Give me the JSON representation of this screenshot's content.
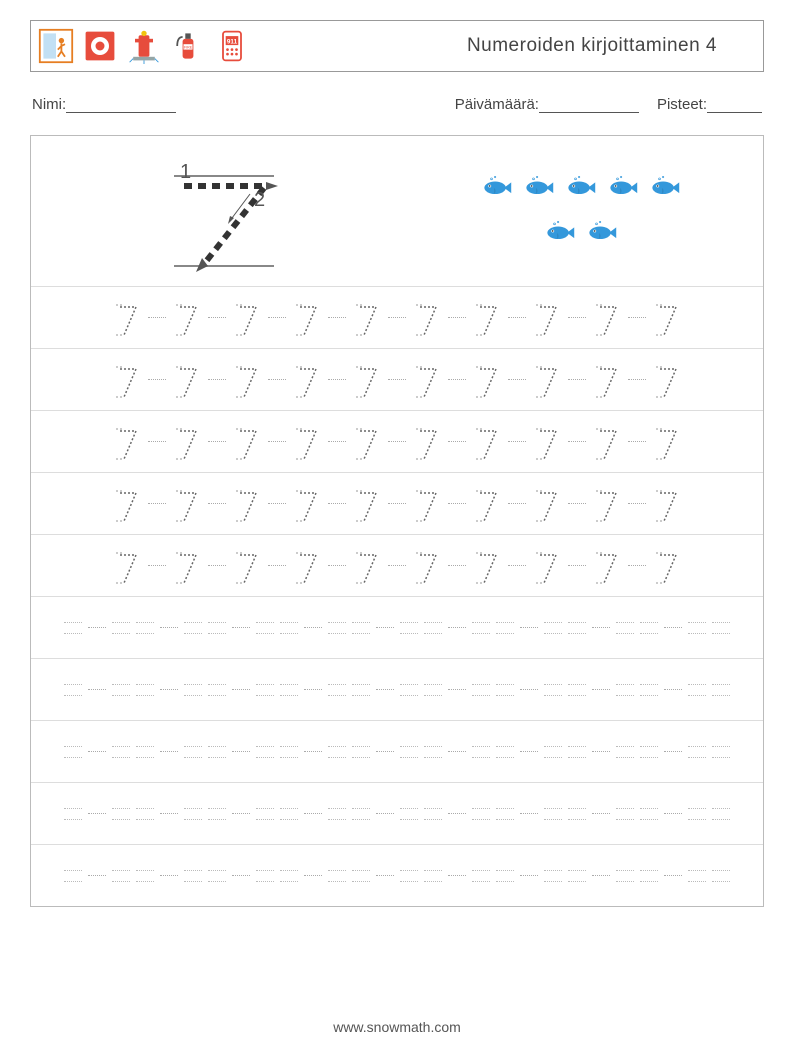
{
  "header": {
    "title": "Numeroiden kirjoittaminen 4",
    "icons": [
      "exit-door-icon",
      "alarm-icon",
      "hydrant-icon",
      "extinguisher-icon",
      "phone-911-icon"
    ]
  },
  "meta": {
    "name_label": "Nimi:",
    "date_label": "Päivämäärä:",
    "score_label": "Pisteet:"
  },
  "example": {
    "digit": 7,
    "stroke_labels": [
      "1",
      "2"
    ],
    "count": 7
  },
  "rows": {
    "traced": 5,
    "blank": 5,
    "per_row": 10
  },
  "footer": {
    "url": "www.snowmath.com"
  }
}
